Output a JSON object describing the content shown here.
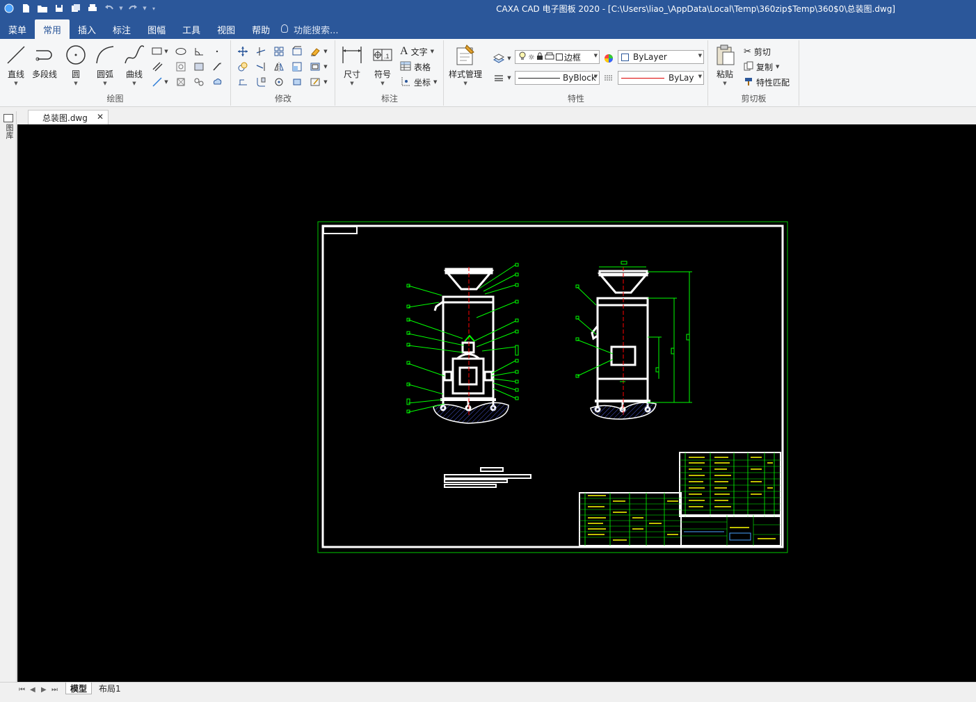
{
  "titlebar": {
    "title": "CAXA CAD 电子图板 2020 - [C:\\Users\\liao_\\AppData\\Local\\Temp\\360zip$Temp\\360$0\\总装图.dwg]"
  },
  "menu": {
    "tabs": [
      "菜单",
      "常用",
      "插入",
      "标注",
      "图幅",
      "工具",
      "视图",
      "帮助"
    ],
    "active_tab": "常用",
    "search_placeholder": "功能搜索..."
  },
  "ribbon": {
    "draw": {
      "label": "绘图",
      "line": "直线",
      "polyline": "多段线",
      "circle": "圆",
      "arc": "圆弧",
      "curve": "曲线"
    },
    "modify": {
      "label": "修改"
    },
    "annotate": {
      "label": "标注",
      "dimension": "尺寸",
      "symbol": "符号",
      "text": "文字",
      "table": "表格",
      "coordinate": "坐标"
    },
    "properties": {
      "label": "特性",
      "style_manager": "样式管理",
      "layer_name": "边框",
      "color_value": "ByLayer",
      "linetype_value": "ByBlock",
      "lineweight_value": "ByLayer"
    },
    "clipboard": {
      "label": "剪切板",
      "paste": "粘贴",
      "cut": "剪切",
      "copy": "复制",
      "match_props": "特性匹配"
    }
  },
  "document": {
    "tab_name": "总装图.dwg"
  },
  "sidebar": {
    "label": "图库"
  },
  "layouts": {
    "tabs": [
      "模型",
      "布局1"
    ],
    "active": "模型"
  },
  "colors": {
    "accent": "#2b579a",
    "canvas": "#000000",
    "frame_green": "#00c800",
    "drawing_white": "#ffffff",
    "hatch_blue": "#1a237e",
    "leader_green": "#00ff00",
    "centerline_red": "#ff0000",
    "table_yellow": "#ffff00"
  }
}
